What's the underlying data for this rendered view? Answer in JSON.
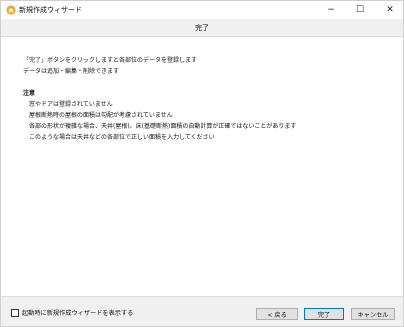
{
  "window": {
    "title": "新規作成ウィザード",
    "minimize": "−",
    "maximize": "☐",
    "close": "✕"
  },
  "header": {
    "step_title": "完了"
  },
  "content": {
    "line1": "「完了」ボタンをクリックしますと各部位のデータを登録します",
    "line2": "データは追加・編集・削除できます",
    "notice_heading": "注意",
    "notes": [
      "窓やドアは登録されていません",
      "屋根断熱時の屋根の面積は勾配が考慮されていません",
      "各部の形状が複雑な場合、天井(屋根)、床(基礎断熱)面積の自動計算が正確ではないことがあります",
      "このような場合は天井などの各部位で正しい面積を入力してください"
    ]
  },
  "footer": {
    "show_wizard_label": "起動時に新規作成ウィザードを表示する",
    "back_label": "< 戻る",
    "finish_label": "完了",
    "cancel_label": "キャンセル"
  }
}
